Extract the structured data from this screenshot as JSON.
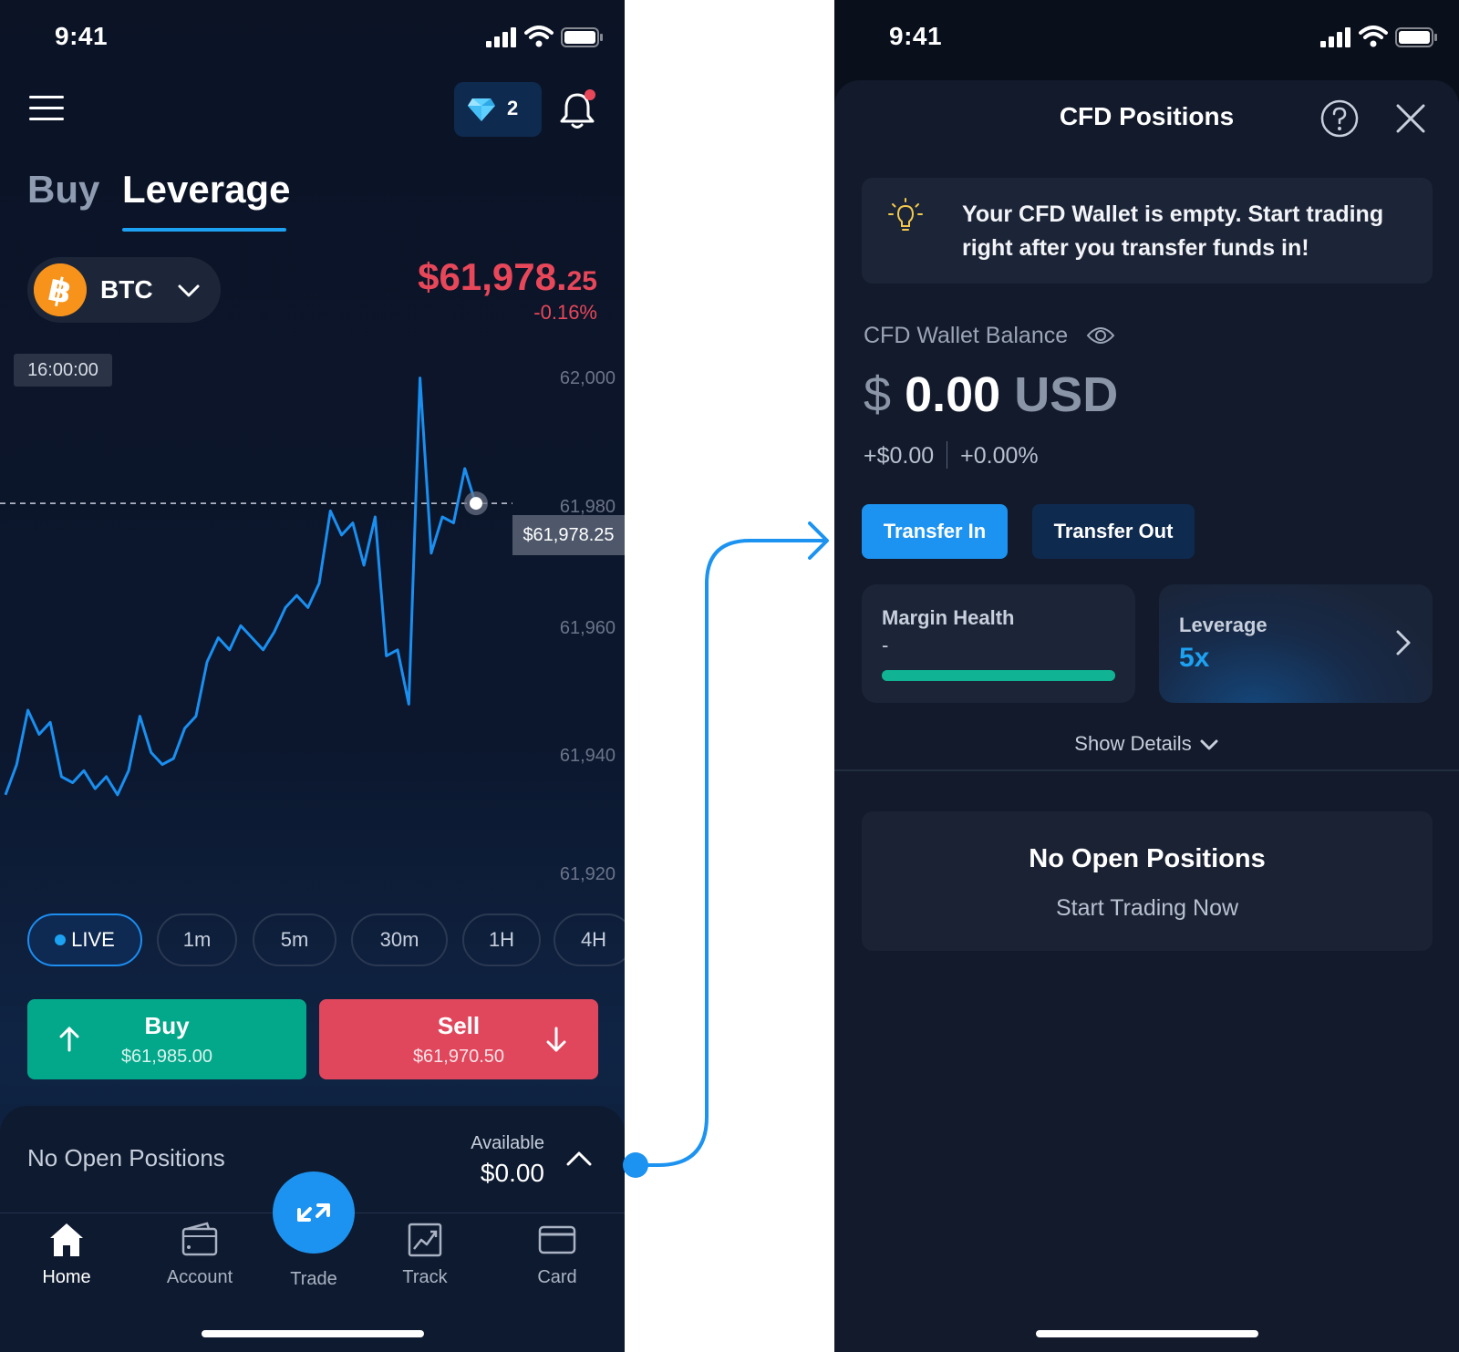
{
  "left": {
    "status": {
      "time": "9:41"
    },
    "gems": {
      "count": "2"
    },
    "tabs": [
      {
        "label": "Buy"
      },
      {
        "label": "Leverage"
      }
    ],
    "coin": {
      "symbol": "BTC"
    },
    "price": {
      "main": "$61,978.",
      "cents": "25",
      "change": "-0.16%"
    },
    "chart_data": {
      "type": "line",
      "time_label": "16:00:00",
      "y_ticks": [
        "62,000",
        "61,980",
        "61,960",
        "61,940",
        "61,920"
      ],
      "ylim": [
        61920,
        62000
      ],
      "current_price_label": "$61,978.25",
      "current_price": 61978.25,
      "series": [
        {
          "values": [
            61930,
            61935,
            61944,
            61940,
            61942,
            61933,
            61932,
            61934,
            61931,
            61933,
            61930,
            61934,
            61943,
            61937,
            61935,
            61936,
            61941,
            61943,
            61952,
            61956,
            61954,
            61958,
            61956,
            61954,
            61957,
            61961,
            61963,
            61961,
            61965,
            61977,
            61973,
            61975,
            61968,
            61976,
            61953,
            61954,
            61945,
            61999,
            61970,
            61976,
            61975,
            61984,
            61978
          ]
        }
      ],
      "line_color": "#1a8ff0"
    },
    "timeframes": [
      "LIVE",
      "1m",
      "5m",
      "30m",
      "1H",
      "4H"
    ],
    "buy": {
      "label": "Buy",
      "price": "$61,985.00"
    },
    "sell": {
      "label": "Sell",
      "price": "$61,970.50"
    },
    "positions": {
      "label": "No Open Positions",
      "available_label": "Available",
      "available_value": "$0.00"
    },
    "nav": [
      {
        "label": "Home",
        "icon": "home-icon"
      },
      {
        "label": "Account",
        "icon": "wallet-icon"
      },
      {
        "label": "Trade",
        "icon": "swap-arrows-icon"
      },
      {
        "label": "Track",
        "icon": "chart-icon"
      },
      {
        "label": "Card",
        "icon": "card-icon"
      }
    ]
  },
  "right": {
    "status": {
      "time": "9:41"
    },
    "title": "CFD Positions",
    "tip": "Your CFD Wallet is empty. Start trading right after you transfer funds in!",
    "balance": {
      "label": "CFD Wallet Balance",
      "symbol": "$",
      "amount": "0.00",
      "currency": "USD",
      "change_abs": "+$0.00",
      "change_pct": "+0.00%"
    },
    "buttons": {
      "transfer_in": "Transfer In",
      "transfer_out": "Transfer Out"
    },
    "margin": {
      "label": "Margin Health",
      "value": "-",
      "health_fraction": 1.0
    },
    "leverage": {
      "label": "Leverage",
      "value": "5x"
    },
    "show_details": "Show Details",
    "empty": {
      "title": "No Open Positions",
      "cta": "Start Trading Now"
    }
  },
  "colors": {
    "accent": "#1c93f0",
    "buy": "#03a88a",
    "sell": "#e0475c",
    "price_down": "#e8475a",
    "health": "#10b394"
  }
}
